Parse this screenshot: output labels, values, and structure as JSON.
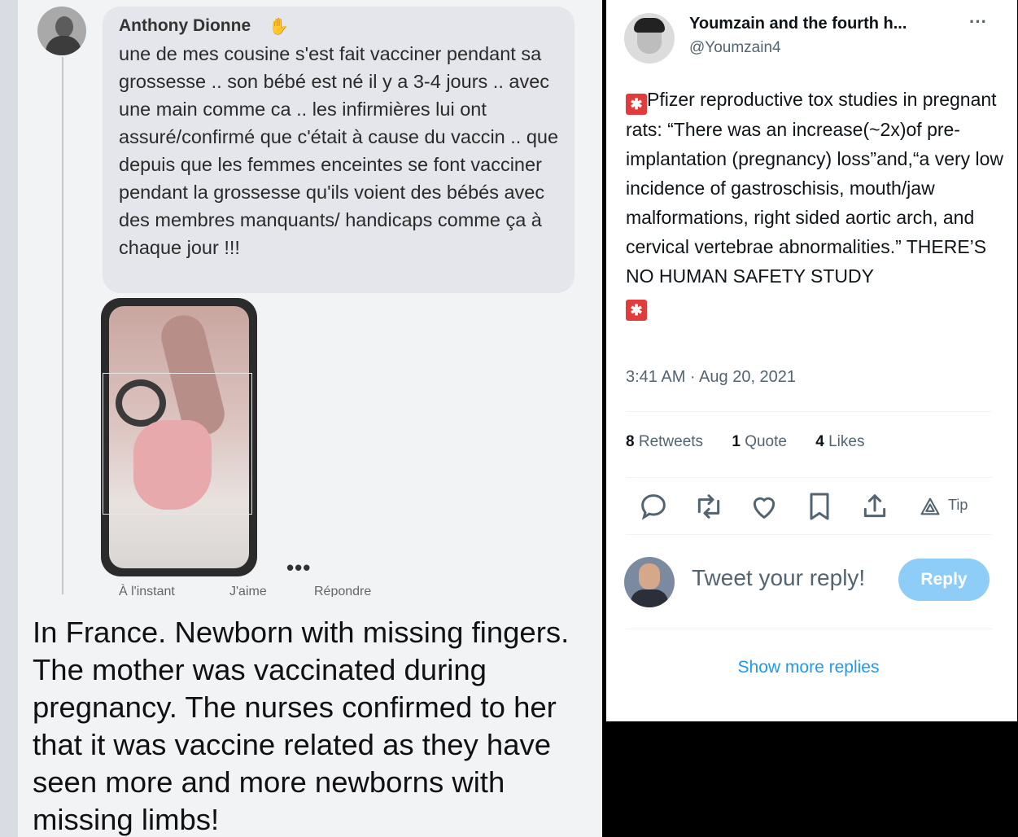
{
  "left_post": {
    "author": "Anthony Dionne",
    "author_icon": "waving-hand-icon",
    "text": "une de mes cousine s'est fait vacciner pendant sa grossesse .. son bébé est né il y a 3-4 jours .. avec une main comme ca .. les infirmières lui ont assuré/confirmé que c'était à cause du vaccin .. que depuis que les femmes enceintes se font vacciner pendant la grossesse qu'ils voient des bébés avec des membres manquants/ handicaps comme ça à chaque jour !!!",
    "more": "•••",
    "actions": [
      "À l'instant",
      "J'aime",
      "Répondre"
    ],
    "caption": "In France. Newborn with missing fingers. The mother was vaccinated during pregnancy. The nurses confirmed to her that it was vaccine related as they have seen more and more newborns with missing limbs!"
  },
  "tweet": {
    "name": "Youmzain and the fourth h...",
    "handle": "@Youmzain4",
    "more": "···",
    "body": "Pfizer reproductive tox studies in pregnant rats: “There was an increase(~2x)of pre-implantation (pregnancy) loss”and,“a very low incidence of gastroschisis, mouth/jaw malformations, right sided aortic arch, and cervical vertebrae abnormalities.” THERE’S NO HUMAN SAFETY STUDY",
    "emoji": "siren-icon",
    "timestamp": "3:41 AM · Aug 20, 2021",
    "stats": {
      "retweets_count": "8",
      "retweets_label": "Retweets",
      "quotes_count": "1",
      "quotes_label": "Quote",
      "likes_count": "4",
      "likes_label": "Likes"
    },
    "tip_label": "Tip",
    "reply_placeholder": "Tweet your reply!",
    "reply_button": "Reply",
    "show_more": "Show more replies",
    "colors": {
      "accent": "#1d9bf0",
      "reply_button": "#8ecdf7",
      "siren": "#e23b3b"
    }
  }
}
